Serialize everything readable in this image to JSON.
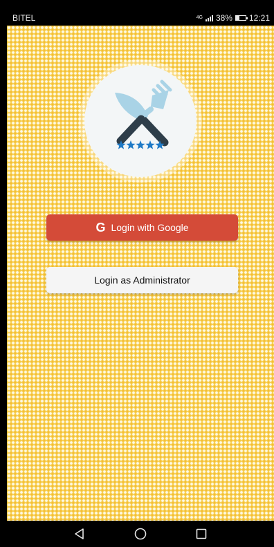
{
  "status_bar": {
    "carrier": "BITEL",
    "network_type": "4G",
    "battery": "38%",
    "battery_level": 0.38,
    "time": "12:21"
  },
  "logo": {
    "icon": "crossed-knife-fork-icon",
    "rating_stars": 5,
    "colors": {
      "utensil_dark": "#2e3e4a",
      "utensil_light": "#a9d3e6",
      "stars": "#1f7ac6"
    }
  },
  "buttons": {
    "google_label": "Login with Google",
    "google_icon": "google-g-icon",
    "admin_label": "Login as Administrator"
  },
  "colors": {
    "google_button": "#d44b38",
    "admin_button": "#f5f5f5",
    "background": "#f6d35a"
  },
  "nav": {
    "back_icon": "back-triangle-icon",
    "home_icon": "home-circle-icon",
    "recents_icon": "recents-square-icon"
  }
}
